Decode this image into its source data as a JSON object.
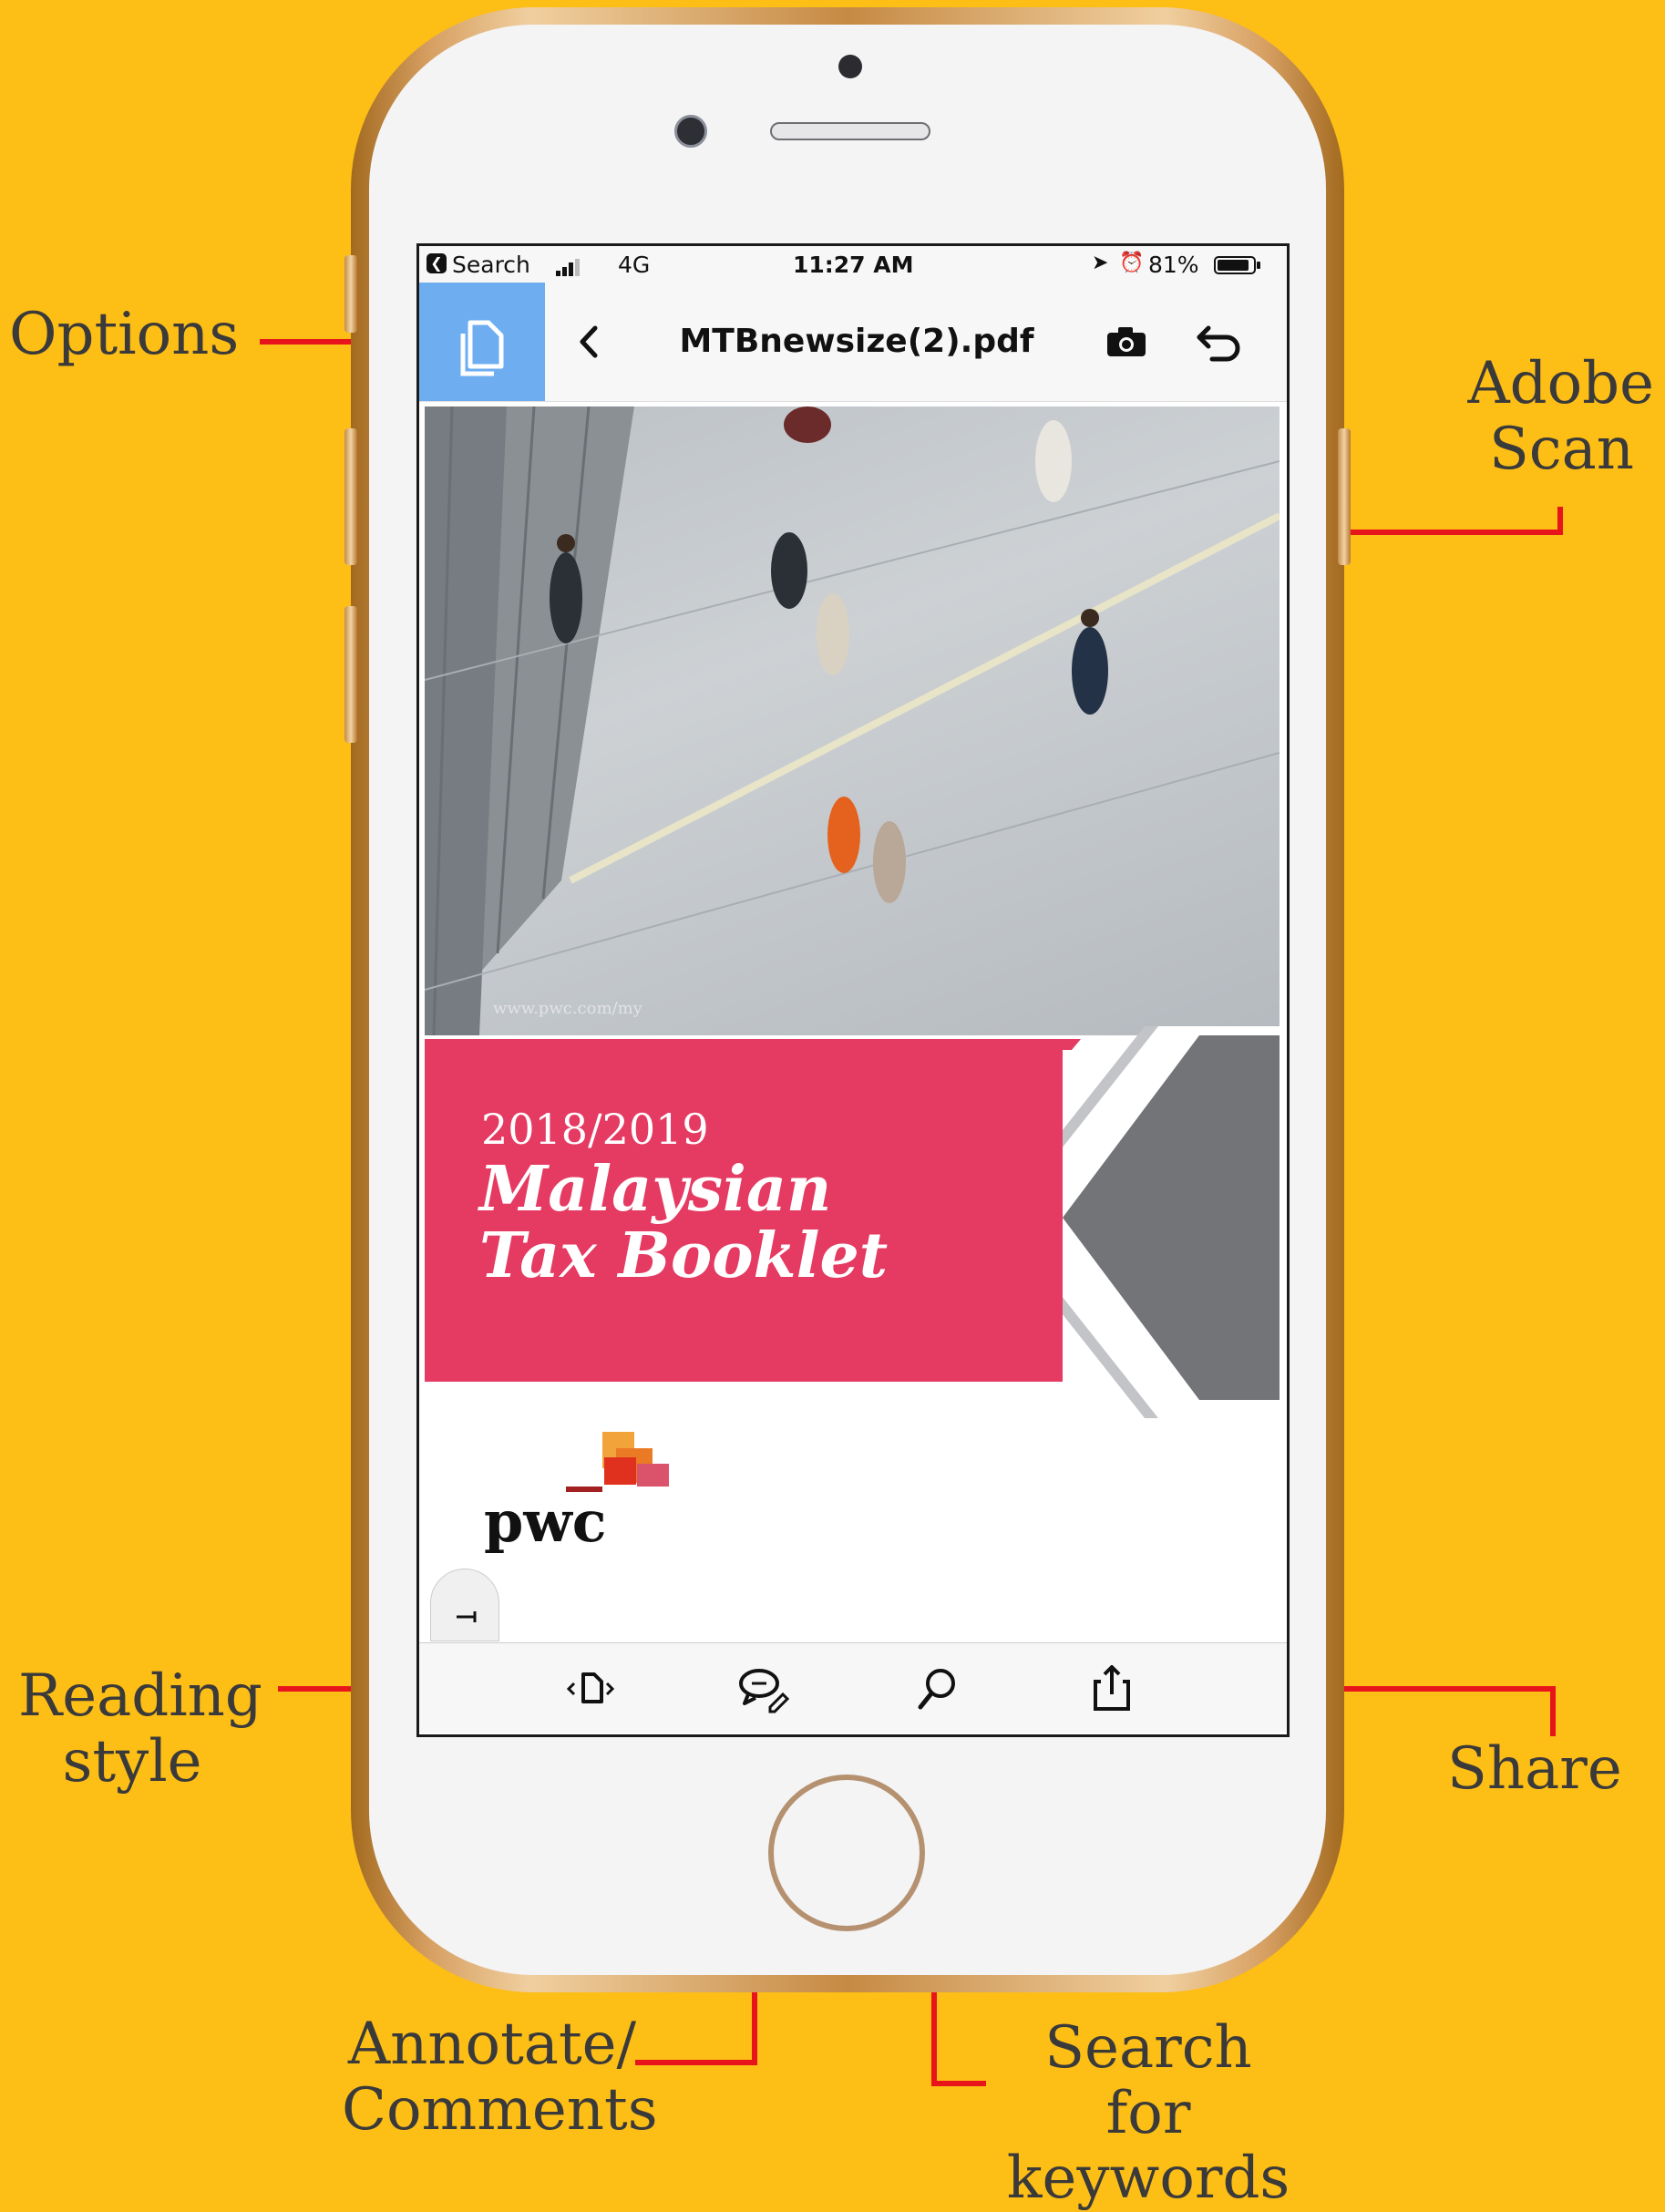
{
  "callouts": {
    "options": "Options",
    "adobe_scan_line1": "Adobe",
    "adobe_scan_line2": "Scan",
    "reading_style_line1": "Reading",
    "reading_style_line2": "style",
    "share": "Share",
    "annotate_line1": "Annotate/",
    "annotate_line2": "Comments",
    "search_line1": "Search for",
    "search_line2": "keywords"
  },
  "status_bar": {
    "back_app": "Search",
    "network": "4G",
    "time": "11:27 AM",
    "battery": "81%"
  },
  "nav": {
    "title": "MTBnewsize(2).pdf"
  },
  "document": {
    "url": "www.pwc.com/my",
    "year": "2018/2019",
    "title_line1": "Malaysian",
    "title_line2": "Tax Booklet",
    "logo_text": "pwc"
  },
  "colors": {
    "background": "#FDBE16",
    "callout_line": "#E8141C",
    "options_button": "#6EAEF0",
    "banner": "#E53A62"
  },
  "icons": {
    "options": "document-copy-icon",
    "back": "chevron-left-icon",
    "camera": "camera-icon",
    "undo": "undo-icon",
    "reading_style": "reading-mode-icon",
    "comment": "comment-pen-icon",
    "search": "search-icon",
    "share": "share-icon"
  }
}
